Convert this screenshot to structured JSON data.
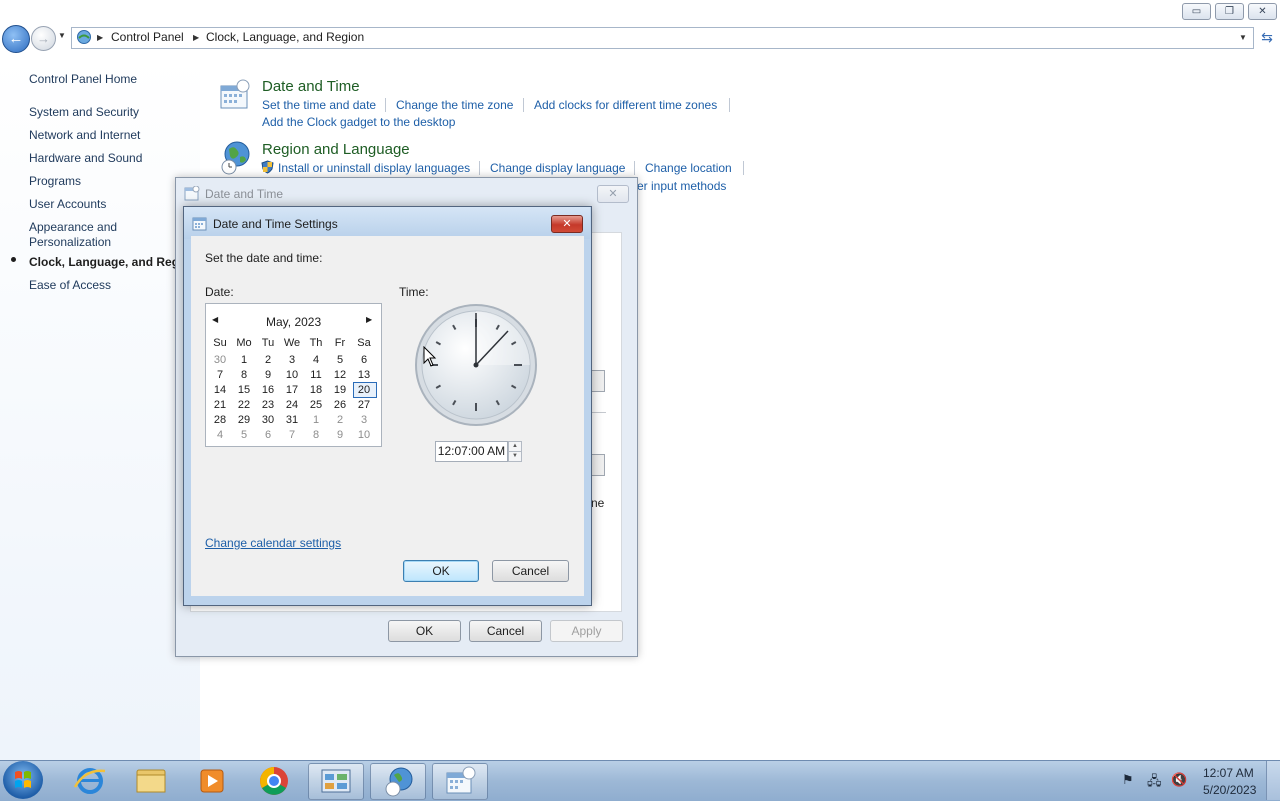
{
  "window": {
    "minimize": "▭",
    "restore": "❐",
    "close": "✕"
  },
  "address": {
    "crumbs": [
      "Control Panel",
      "Clock, Language, and Region"
    ]
  },
  "sidebar": {
    "home": "Control Panel Home",
    "items": [
      {
        "label": "System and Security"
      },
      {
        "label": "Network and Internet"
      },
      {
        "label": "Hardware and Sound"
      },
      {
        "label": "Programs"
      },
      {
        "label": "User Accounts"
      },
      {
        "label": "Appearance and\nPersonalization"
      },
      {
        "label": "Clock, Language, and Regio"
      },
      {
        "label": "Ease of Access"
      }
    ]
  },
  "main": {
    "date_time": {
      "title": "Date and Time",
      "links": [
        "Set the time and date",
        "Change the time zone",
        "Add clocks for different time zones",
        "Add the Clock gadget to the desktop"
      ]
    },
    "region": {
      "title": "Region and Language",
      "links": [
        "Install or uninstall display languages",
        "Change display language",
        "Change location",
        "er input methods"
      ]
    }
  },
  "outer_dialog": {
    "title": "Date and Time",
    "fragment": "ne",
    "ok": "OK",
    "cancel": "Cancel",
    "apply": "Apply"
  },
  "inner_dialog": {
    "title": "Date and Time Settings",
    "prompt": "Set the date and time:",
    "date_label": "Date:",
    "time_label": "Time:",
    "calendar": {
      "month": "May, 2023",
      "weekdays": [
        "Su",
        "Mo",
        "Tu",
        "We",
        "Th",
        "Fr",
        "Sa"
      ],
      "weeks": [
        [
          "30",
          "1",
          "2",
          "3",
          "4",
          "5",
          "6"
        ],
        [
          "7",
          "8",
          "9",
          "10",
          "11",
          "12",
          "13"
        ],
        [
          "14",
          "15",
          "16",
          "17",
          "18",
          "19",
          "20"
        ],
        [
          "21",
          "22",
          "23",
          "24",
          "25",
          "26",
          "27"
        ],
        [
          "28",
          "29",
          "30",
          "31",
          "1",
          "2",
          "3"
        ],
        [
          "4",
          "5",
          "6",
          "7",
          "8",
          "9",
          "10"
        ]
      ],
      "selected": "20"
    },
    "time_value": "12:07:00 AM",
    "calendar_settings_link": "Change calendar settings",
    "ok": "OK",
    "cancel": "Cancel"
  },
  "taskbar": {
    "clock_time": "12:07 AM",
    "clock_date": "5/20/2023"
  }
}
